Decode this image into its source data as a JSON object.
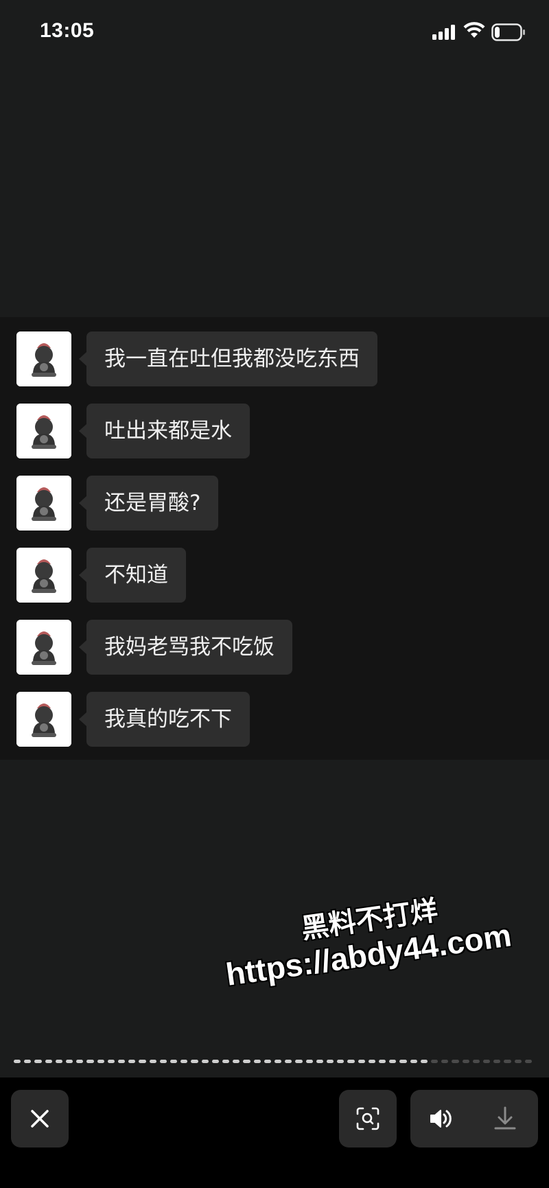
{
  "status_bar": {
    "time": "13:05",
    "signal_icon": "cellular-signal-icon",
    "wifi_icon": "wifi-icon",
    "battery_icon": "battery-icon",
    "battery_level": 0.2
  },
  "chat": {
    "messages": [
      {
        "text": "我一直在吐但我都没吃东西",
        "avatar_icon": "avatar-icon"
      },
      {
        "text": "吐出来都是水",
        "avatar_icon": "avatar-icon"
      },
      {
        "text": "还是胃酸?",
        "avatar_icon": "avatar-icon"
      },
      {
        "text": "不知道",
        "avatar_icon": "avatar-icon"
      },
      {
        "text": "我妈老骂我不吃饭",
        "avatar_icon": "avatar-icon"
      },
      {
        "text": "我真的吃不下",
        "avatar_icon": "avatar-icon"
      }
    ]
  },
  "watermark": {
    "line1": "黑料不打烊",
    "line2": "https://abdy44.com"
  },
  "playback": {
    "segment_count": 50,
    "played_segments": 40
  },
  "controls": {
    "close_icon": "close-icon",
    "scan_icon": "scan-icon",
    "volume_icon": "volume-icon",
    "download_icon": "download-icon"
  },
  "colors": {
    "background": "#1b1c1c",
    "chat_background": "#141414",
    "bubble": "#2e2e2e",
    "bottom_bar": "#000000",
    "button": "#2a2a2a"
  }
}
